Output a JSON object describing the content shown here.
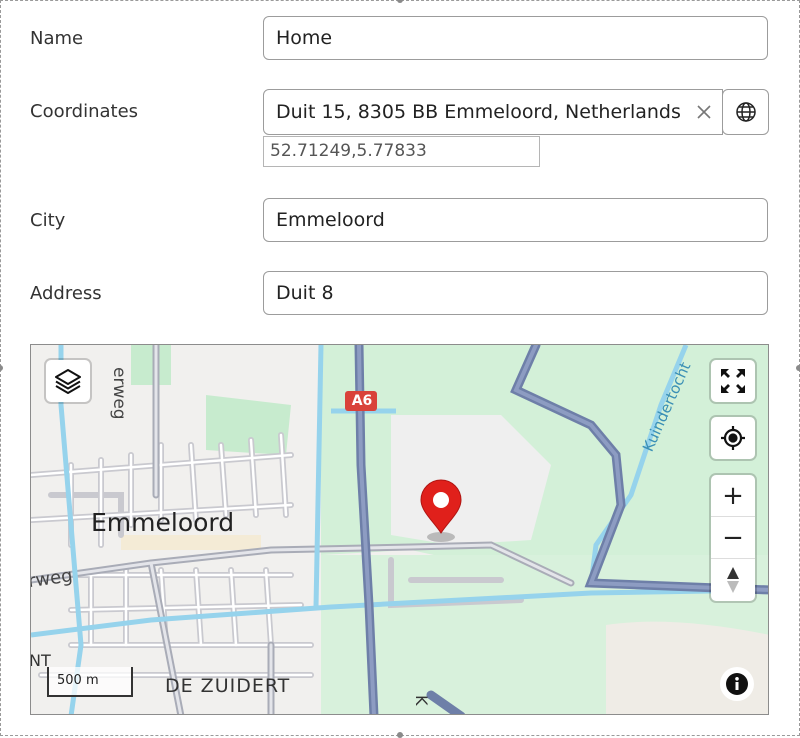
{
  "form": {
    "name": {
      "label": "Name",
      "value": "Home"
    },
    "coordinates": {
      "label": "Coordinates",
      "value": "Duit 15, 8305 BB Emmeloord, Netherlands",
      "clear_icon": "close-icon",
      "geocode_icon": "globe-icon",
      "latlng": "52.71249,5.77833"
    },
    "city": {
      "label": "City",
      "value": "Emmeloord"
    },
    "address": {
      "label": "Address",
      "value": "Duit 8"
    }
  },
  "map": {
    "labels": {
      "town": "Emmeloord",
      "district": "DE ZUIDERT",
      "road_weg_top": "erweg",
      "road_weg_left": "erweg",
      "canal": "Kuindertocht",
      "highway_shield": "A6",
      "edge_n": "NT",
      "edge_k": "K"
    },
    "scale_label": "500 m",
    "zoom_in": "+",
    "zoom_out": "−",
    "marker_color": "#e0201b",
    "controls": [
      "layers-icon",
      "fullscreen-icon",
      "locate-icon",
      "zoom-in",
      "zoom-out",
      "compass-icon",
      "info-icon"
    ]
  }
}
